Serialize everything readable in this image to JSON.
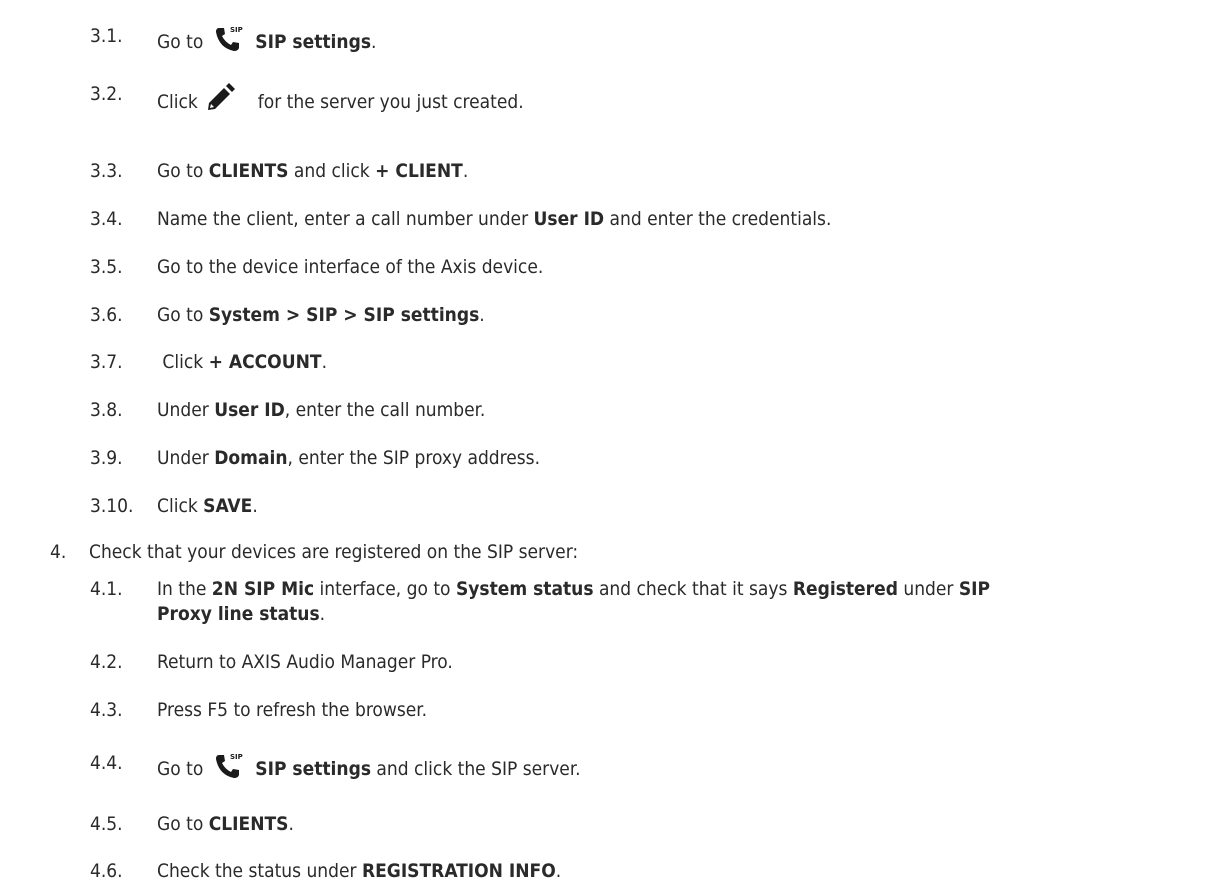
{
  "steps": [
    {
      "num": "3.1.",
      "pre": "Go to",
      "icon": "sip-phone-icon",
      "bold1": "SIP settings",
      "post": "."
    },
    {
      "num": "3.2.",
      "pre": "Click",
      "icon": "pencil-icon",
      "mid": "for the server you just created."
    },
    {
      "num": "3.3.",
      "pre": "Go to ",
      "bold1": "CLIENTS",
      "mid": " and click ",
      "bold2": "+ CLIENT",
      "post": "."
    },
    {
      "num": "3.4.",
      "pre": "Name the client, enter a call number under ",
      "bold1": "User ID",
      "mid": " and enter the credentials."
    },
    {
      "num": "3.5.",
      "pre": "Go to the device interface of the Axis device."
    },
    {
      "num": "3.6.",
      "pre": "Go to ",
      "bold1": "System > SIP > SIP settings",
      "post": "."
    },
    {
      "num": "3.7.",
      "pre": " Click ",
      "bold1": "+ ACCOUNT",
      "post": "."
    },
    {
      "num": "3.8.",
      "pre": "Under ",
      "bold1": "User ID",
      "mid": ", enter the call number."
    },
    {
      "num": "3.9.",
      "pre": "Under ",
      "bold1": "Domain",
      "mid": ", enter the SIP proxy address."
    },
    {
      "num": "3.10.",
      "pre": "Click ",
      "bold1": "SAVE",
      "post": "."
    }
  ],
  "step4": {
    "num": "4.",
    "text": "Check that your devices are registered on the SIP server:"
  },
  "substeps": [
    {
      "num": "4.1.",
      "pre": "In the ",
      "bold1": "2N SIP Mic",
      "mid": " interface, go to ",
      "bold2": "System status",
      "mid2": " and check that it says ",
      "bold3": "Registered",
      "mid3": " under ",
      "bold4": "SIP",
      "line2": "Proxy line status",
      "post": "."
    },
    {
      "num": "4.2.",
      "pre": "Return to AXIS Audio Manager Pro."
    },
    {
      "num": "4.3.",
      "pre": "Press F5 to refresh the browser."
    },
    {
      "num": "4.4.",
      "pre": "Go to",
      "icon": "sip-phone-icon",
      "bold1": "SIP settings",
      "mid": " and click the SIP server."
    },
    {
      "num": "4.5.",
      "pre": "Go to ",
      "bold1": "CLIENTS",
      "post": "."
    },
    {
      "num": "4.6.",
      "pre": "Check the status under ",
      "bold1": "REGISTRATION INFO",
      "post": "."
    }
  ],
  "icon_labels": {
    "sip": "SIP"
  }
}
